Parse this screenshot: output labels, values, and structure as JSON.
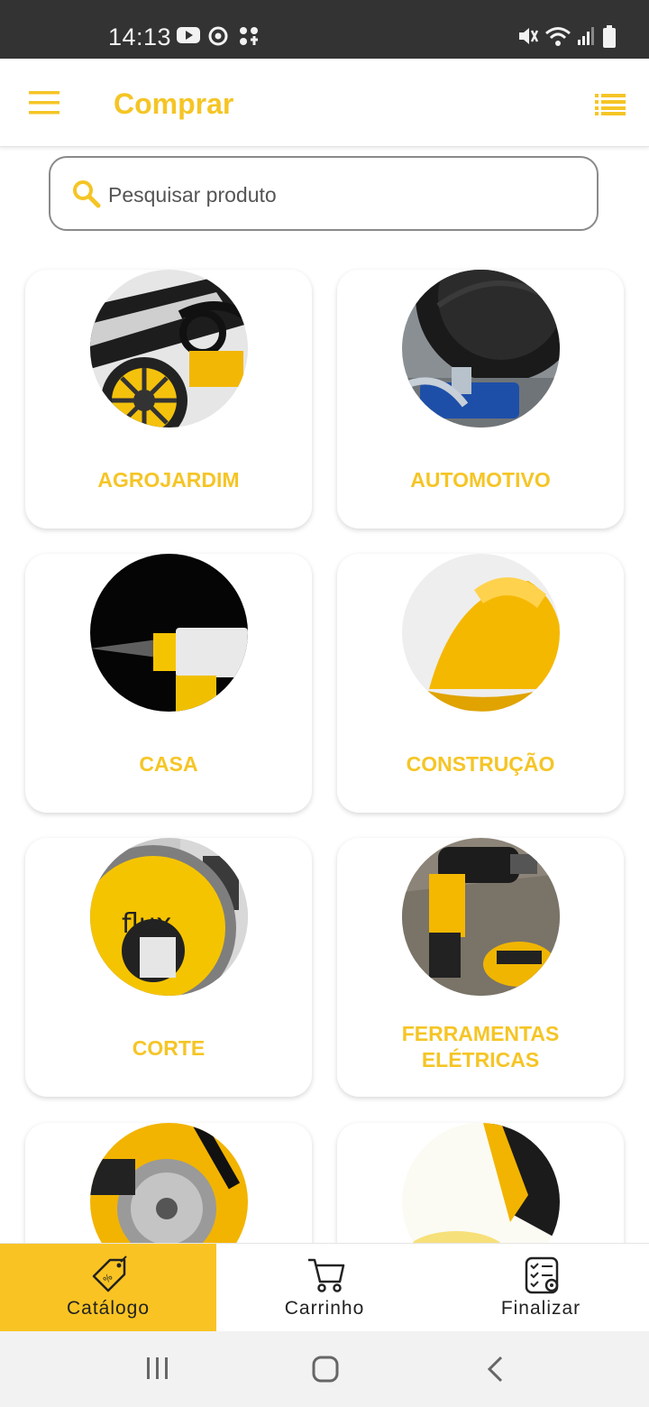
{
  "status_bar": {
    "time": "14:13",
    "icons": [
      "youtube-icon",
      "sync-icon",
      "apps-icon",
      "mute-icon",
      "wifi-icon",
      "signal-icon",
      "battery-icon"
    ]
  },
  "app_bar": {
    "title": "Comprar",
    "left_icon": "menu-icon",
    "right_icon": "list-icon"
  },
  "search": {
    "placeholder": "Pesquisar produto",
    "value": ""
  },
  "categories": [
    {
      "label": "AGROJARDIM",
      "image": "lawn-mower"
    },
    {
      "label": "AUTOMOTIVO",
      "image": "car-jack"
    },
    {
      "label": "CASA",
      "image": "spray-bottle"
    },
    {
      "label": "CONSTRUÇÃO",
      "image": "hard-hat"
    },
    {
      "label": "CORTE",
      "image": "cutting-disc",
      "image_text": "flux"
    },
    {
      "label_line1": "FERRAMENTAS",
      "label_line2": "ELÉTRICAS",
      "image": "drill"
    },
    {
      "label": "",
      "image": "saw-tools"
    },
    {
      "label": "",
      "image": "yellow-tool"
    }
  ],
  "bottom_nav": [
    {
      "label": "Catálogo",
      "icon": "tag-icon",
      "active": true
    },
    {
      "label": "Carrinho",
      "icon": "cart-icon",
      "active": false
    },
    {
      "label": "Finalizar",
      "icon": "checklist-icon",
      "active": false
    }
  ],
  "colors": {
    "accent": "#F5C526",
    "nav_active": "#F9C423",
    "status_bar": "#333333"
  }
}
